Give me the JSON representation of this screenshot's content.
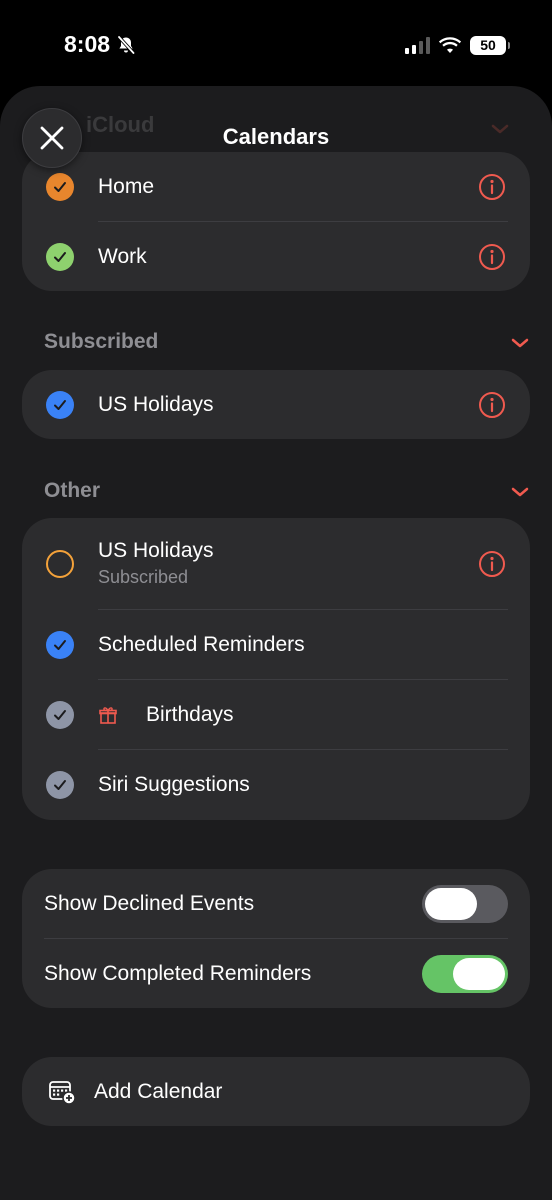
{
  "status_bar": {
    "time": "8:08",
    "battery": "50"
  },
  "header": {
    "title": "Calendars",
    "ghost_text": "iCloud"
  },
  "colors": {
    "home": "#e8862d",
    "work": "#8ed16e",
    "blue": "#3a82f6",
    "gray": "#8e95a6",
    "orange_outline": "#f4a23a",
    "accent": "#f05a4f",
    "toggle_on": "#65c466"
  },
  "icloud": {
    "items": [
      {
        "label": "Home",
        "checked": true
      },
      {
        "label": "Work",
        "checked": true
      }
    ]
  },
  "subscribed": {
    "title": "Subscribed",
    "items": [
      {
        "label": "US Holidays",
        "checked": true
      }
    ]
  },
  "other": {
    "title": "Other",
    "items": [
      {
        "label": "US Holidays",
        "sublabel": "Subscribed",
        "checked": false
      },
      {
        "label": "Scheduled Reminders",
        "checked": true
      },
      {
        "label": "Birthdays",
        "checked": true
      },
      {
        "label": "Siri Suggestions",
        "checked": true
      }
    ]
  },
  "settings": {
    "items": [
      {
        "label": "Show Declined Events",
        "on": false
      },
      {
        "label": "Show Completed Reminders",
        "on": true
      }
    ]
  },
  "add_calendar": {
    "label": "Add Calendar"
  }
}
